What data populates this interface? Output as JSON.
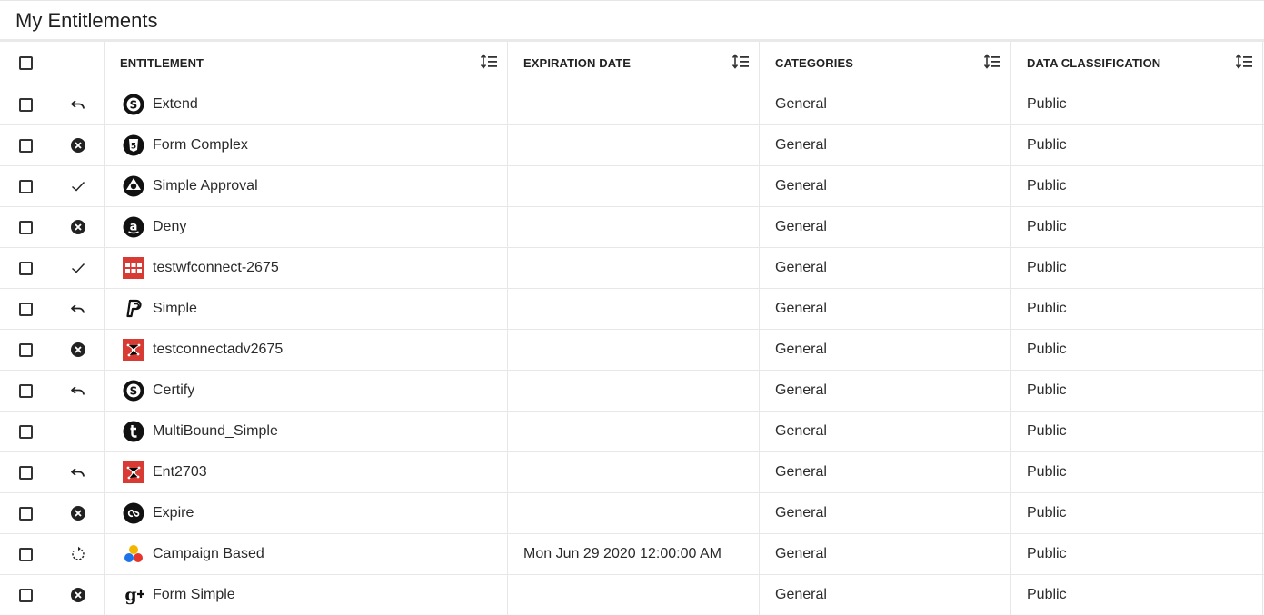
{
  "page": {
    "title": "My Entitlements"
  },
  "columns": {
    "entitlement": "ENTITLEMENT",
    "expiration_date": "EXPIRATION DATE",
    "categories": "CATEGORIES",
    "data_classification": "DATA CLASSIFICATION"
  },
  "rows": [
    {
      "action_icon": "undo-icon",
      "app_icon": "skype-icon",
      "entitlement": "Extend",
      "expiration_date": "",
      "category": "General",
      "classification": "Public"
    },
    {
      "action_icon": "cancel-circle-icon",
      "app_icon": "html5-icon",
      "entitlement": "Form Complex",
      "expiration_date": "",
      "category": "General",
      "classification": "Public"
    },
    {
      "action_icon": "check-icon",
      "app_icon": "picasa-icon",
      "entitlement": "Simple Approval",
      "expiration_date": "",
      "category": "General",
      "classification": "Public"
    },
    {
      "action_icon": "cancel-circle-icon",
      "app_icon": "amazon-icon",
      "entitlement": "Deny",
      "expiration_date": "",
      "category": "General",
      "classification": "Public"
    },
    {
      "action_icon": "check-icon",
      "app_icon": "red-grid-app-icon",
      "entitlement": "testwfconnect-2675",
      "expiration_date": "",
      "category": "General",
      "classification": "Public"
    },
    {
      "action_icon": "undo-icon",
      "app_icon": "paypal-icon",
      "entitlement": "Simple",
      "expiration_date": "",
      "category": "General",
      "classification": "Public"
    },
    {
      "action_icon": "cancel-circle-icon",
      "app_icon": "red-network-app-icon",
      "entitlement": "testconnectadv2675",
      "expiration_date": "",
      "category": "General",
      "classification": "Public"
    },
    {
      "action_icon": "undo-icon",
      "app_icon": "skype-icon",
      "entitlement": "Certify",
      "expiration_date": "",
      "category": "General",
      "classification": "Public"
    },
    {
      "action_icon": "",
      "app_icon": "tumblr-icon",
      "entitlement": "MultiBound_Simple",
      "expiration_date": "",
      "category": "General",
      "classification": "Public"
    },
    {
      "action_icon": "undo-icon",
      "app_icon": "red-network-app-icon",
      "entitlement": "Ent2703",
      "expiration_date": "",
      "category": "General",
      "classification": "Public"
    },
    {
      "action_icon": "cancel-circle-icon",
      "app_icon": "lastfm-icon",
      "entitlement": "Expire",
      "expiration_date": "",
      "category": "General",
      "classification": "Public"
    },
    {
      "action_icon": "renew-icon",
      "app_icon": "campaign-circles-icon",
      "entitlement": "Campaign Based",
      "expiration_date": "Mon Jun 29 2020 12:00:00 AM",
      "category": "General",
      "classification": "Public"
    },
    {
      "action_icon": "cancel-circle-icon",
      "app_icon": "google-plus-icon",
      "entitlement": "Form Simple",
      "expiration_date": "",
      "category": "General",
      "classification": "Public"
    }
  ]
}
